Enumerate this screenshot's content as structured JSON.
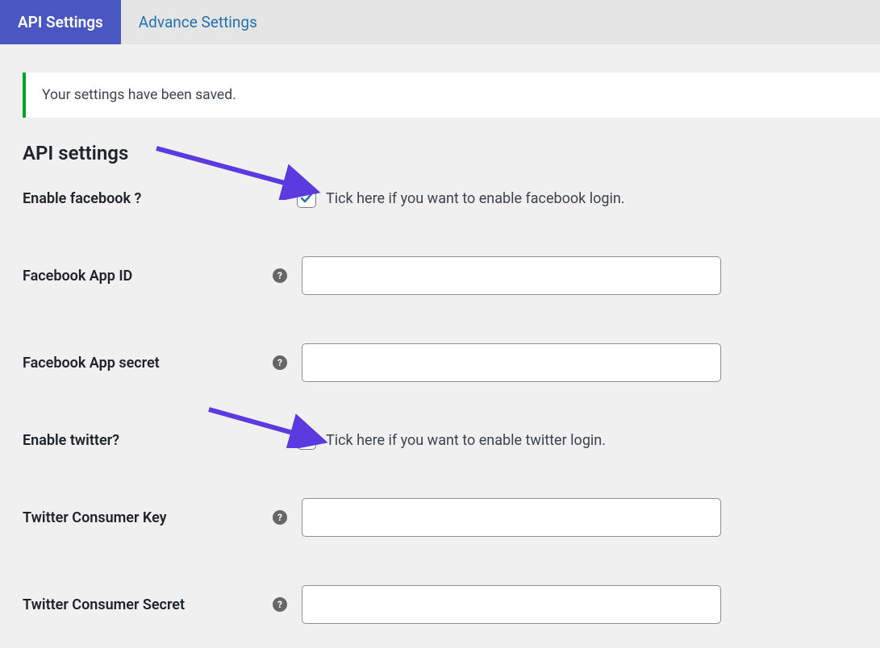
{
  "tabs": {
    "api": "API Settings",
    "advance": "Advance Settings"
  },
  "notice": "Your settings have been saved.",
  "section_title": "API settings",
  "rows": {
    "enable_facebook": {
      "label": "Enable facebook ?",
      "desc": "Tick here if you want to enable facebook login.",
      "checked": true
    },
    "fb_app_id": {
      "label": "Facebook App ID",
      "value": ""
    },
    "fb_app_secret": {
      "label": "Facebook App secret",
      "value": ""
    },
    "enable_twitter": {
      "label": "Enable twitter?",
      "desc": "Tick here if you want to enable twitter login.",
      "checked": true
    },
    "tw_consumer_key": {
      "label": "Twitter Consumer Key",
      "value": ""
    },
    "tw_consumer_secret": {
      "label": "Twitter Consumer Secret",
      "value": ""
    }
  },
  "colors": {
    "accent": "#4a57c3",
    "link": "#2271b1",
    "success": "#00a32a",
    "arrow": "#5b3be0",
    "check": "#2271b1"
  }
}
